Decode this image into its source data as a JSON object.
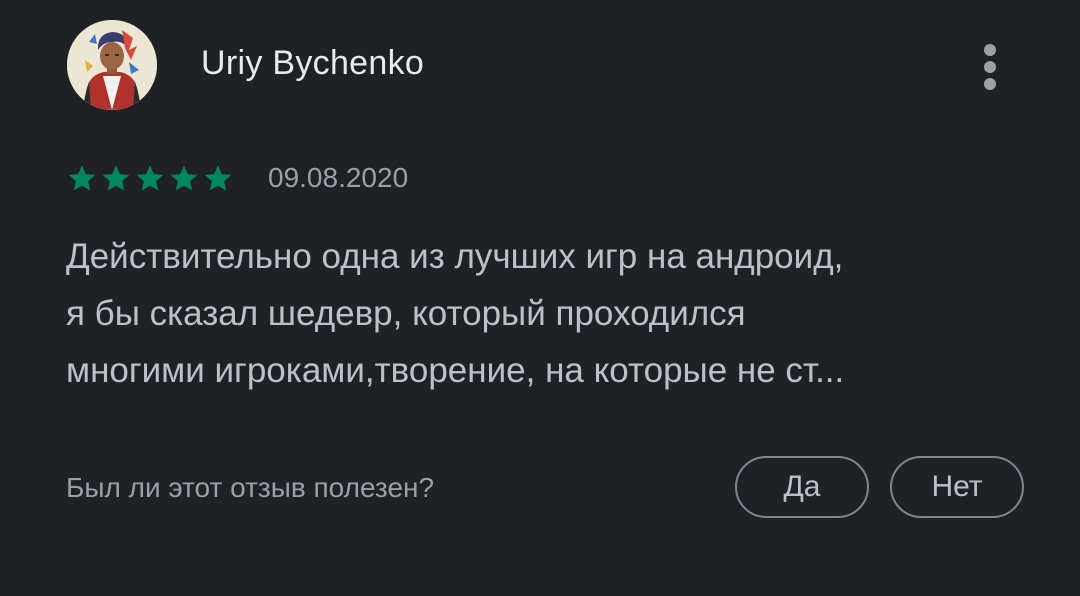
{
  "reviewer": {
    "name": "Uriy Bychenko",
    "avatar_icon": "user-avatar-illustration"
  },
  "more_icon": "more-vert-icon",
  "rating": {
    "stars": 5,
    "max": 5,
    "star_color": "#01875f",
    "date": "09.08.2020"
  },
  "review": {
    "lines": [
      "Действительно одна из лучших игр на андроид,",
      "я бы сказал шедевр, который проходился",
      "многими игроками,творение, на которые не ст..."
    ]
  },
  "helpful": {
    "question": "Был ли этот отзыв полезен?",
    "yes_label": "Да",
    "no_label": "Нет"
  },
  "colors": {
    "background": "#202124",
    "name": "#e8eaed",
    "body_text": "#bdc1c6",
    "secondary_text": "#9aa0a6",
    "button_border": "#80868b"
  }
}
